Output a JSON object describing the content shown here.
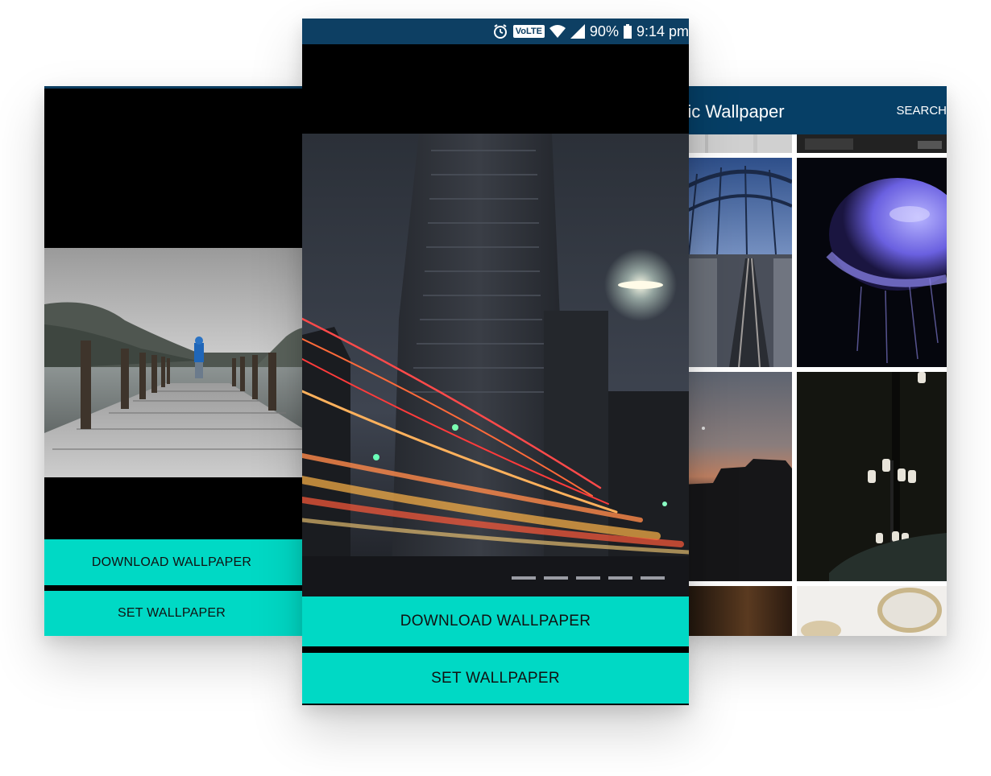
{
  "left_screen": {
    "download_label": "DOWNLOAD WALLPAPER",
    "set_label": "SET WALLPAPER"
  },
  "center_screen": {
    "status_bar": {
      "alarm_icon": "alarm-icon",
      "volte_text": "VoLTE",
      "battery_percent": "90%",
      "time": "9:14 pm"
    },
    "download_label": "DOWNLOAD WALLPAPER",
    "set_label": "SET WALLPAPER"
  },
  "right_screen": {
    "title": "mic Wallpaper",
    "search_label": "SEARCH"
  },
  "colors": {
    "accent": "#00d9c5",
    "toolbar": "#063f66",
    "statusbar": "#0d3f63"
  }
}
